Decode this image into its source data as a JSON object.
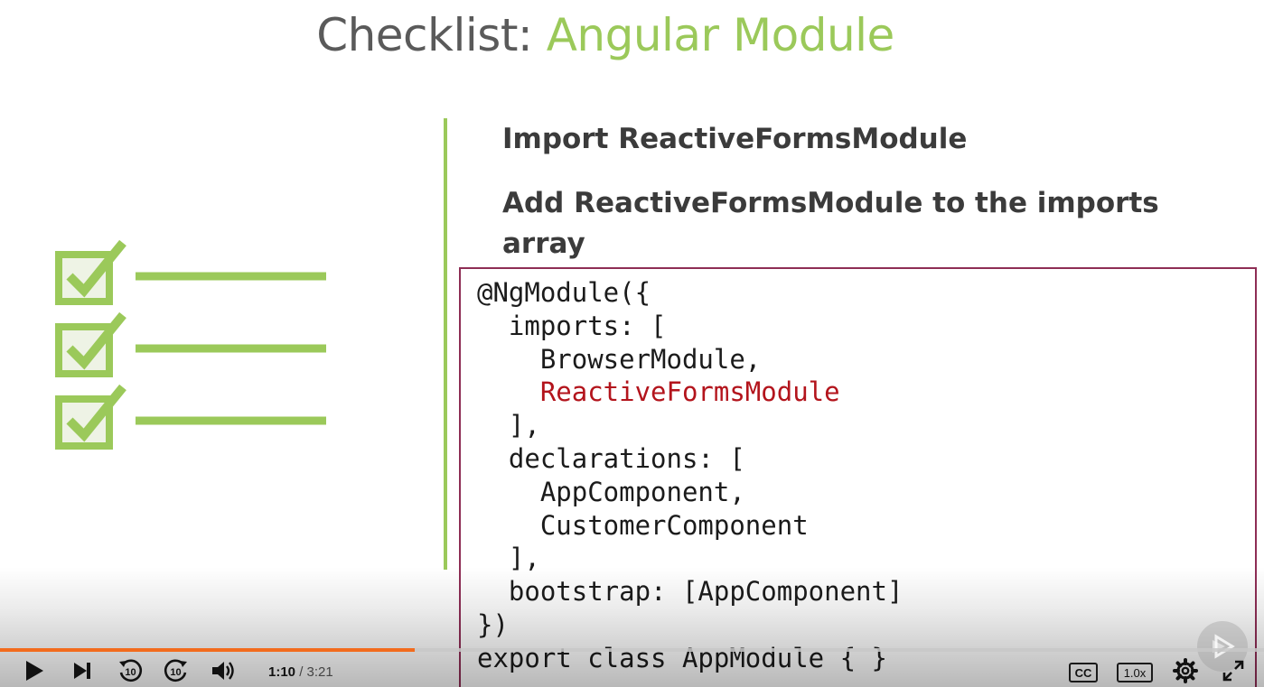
{
  "slide": {
    "title_prefix": "Checklist: ",
    "title_highlight": "Angular Module",
    "bullets": [
      "Import ReactiveFormsModule",
      "Add ReactiveFormsModule to the imports array"
    ],
    "code": {
      "line1": "@NgModule({",
      "line2": "  imports: [",
      "line3": "    BrowserModule,",
      "line4_highlight": "    ReactiveFormsModule",
      "line5": "  ],",
      "line6": "  declarations: [",
      "line7": "    AppComponent,",
      "line8": "    CustomerComponent",
      "line9": "  ],",
      "line10": "  bootstrap: [AppComponent]",
      "line11": "})",
      "line12": "export class AppModule { }"
    }
  },
  "player": {
    "current_time": "1:10",
    "separator": " / ",
    "total_time": "3:21",
    "progress": 0.328,
    "speed_label": "1.0x",
    "cc_label": "CC",
    "rewind_label": "10",
    "forward_label": "10",
    "icons": [
      "play-icon",
      "skip-next-icon",
      "rewind-10-icon",
      "forward-10-icon",
      "volume-icon",
      "captions-icon",
      "speed-icon",
      "settings-icon",
      "fullscreen-icon"
    ],
    "accent_color": "#f26b1d"
  },
  "colors": {
    "title_gray": "#5a5a5a",
    "title_green": "#9bc95a",
    "code_box_border": "#8e2d55",
    "code_highlight": "#b3141c"
  }
}
